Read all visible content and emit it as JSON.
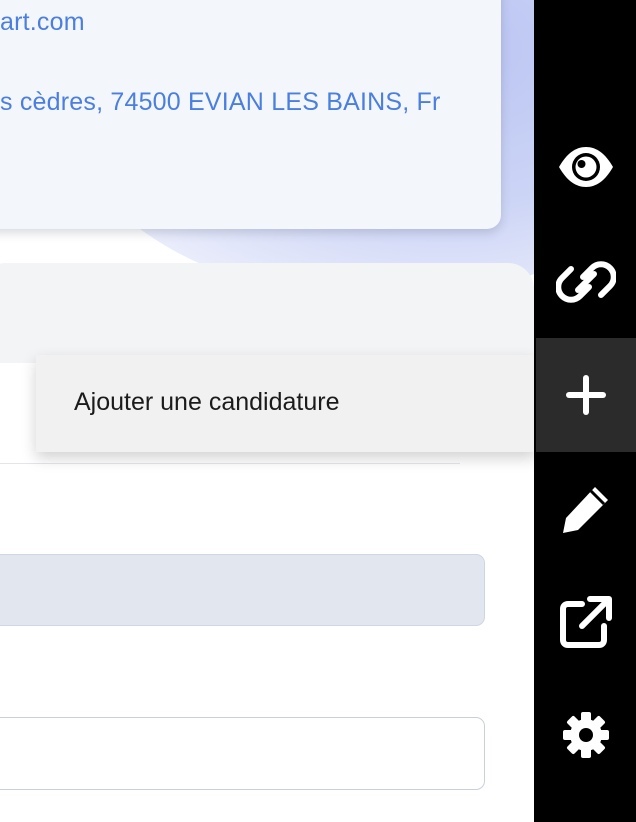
{
  "contact": {
    "email": "art.com",
    "address": "s cèdres, 74500 EVIAN LES BAINS, Fr"
  },
  "tooltip": {
    "label": "Ajouter une candidature"
  },
  "toolbar": {
    "buttons": [
      {
        "name": "view",
        "icon": "eye-icon"
      },
      {
        "name": "link",
        "icon": "link-icon"
      },
      {
        "name": "add",
        "icon": "plus-icon",
        "active": true
      },
      {
        "name": "edit",
        "icon": "pencil-icon"
      },
      {
        "name": "open-external",
        "icon": "external-link-icon"
      },
      {
        "name": "settings",
        "icon": "gear-icon"
      }
    ]
  },
  "colors": {
    "link_text": "#4a7ee0",
    "toolbar_bg": "#000000",
    "toolbar_active_bg": "#2b2b2b",
    "card_bg": "#f3f7fb",
    "readonly_field_bg": "#e2e7ef"
  }
}
